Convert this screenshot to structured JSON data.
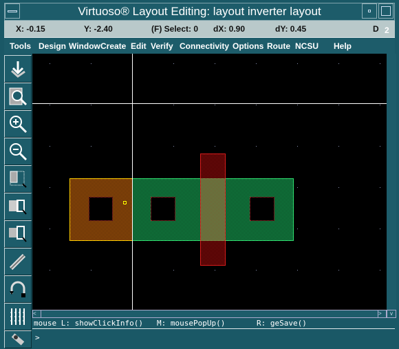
{
  "window": {
    "title": "Virtuoso® Layout Editing: layout inverter layout"
  },
  "status": {
    "x": "X: -0.15",
    "y": "Y: -2.40",
    "select": "(F) Select: 0",
    "dx": "dX:  0.90",
    "dy": "dY:  0.45",
    "d": "D",
    "badge": "2"
  },
  "menu": [
    "Tools",
    "Design",
    "Window",
    "Create",
    "Edit",
    "Verify",
    "Connectivity",
    "Options",
    "Route",
    "NCSU",
    "Help"
  ],
  "toolbar": [
    "save-icon",
    "zoom-fit-icon",
    "zoom-in-icon",
    "zoom-out-icon",
    "stretch-icon",
    "copy-icon",
    "move-icon",
    "edit-properties-icon",
    "undo-icon",
    "ruler-icon",
    "path-icon"
  ],
  "mouse": {
    "left": "mouse L: showClickInfo()",
    "middle": "M: mousePopUp()",
    "right": "R: geSave()"
  },
  "command": {
    "prompt": ">"
  },
  "colors": {
    "pdiff": "#f07a10",
    "ndiff": "#1ed06a",
    "poly": "#d81010",
    "chrome": "#1d5c6a"
  }
}
